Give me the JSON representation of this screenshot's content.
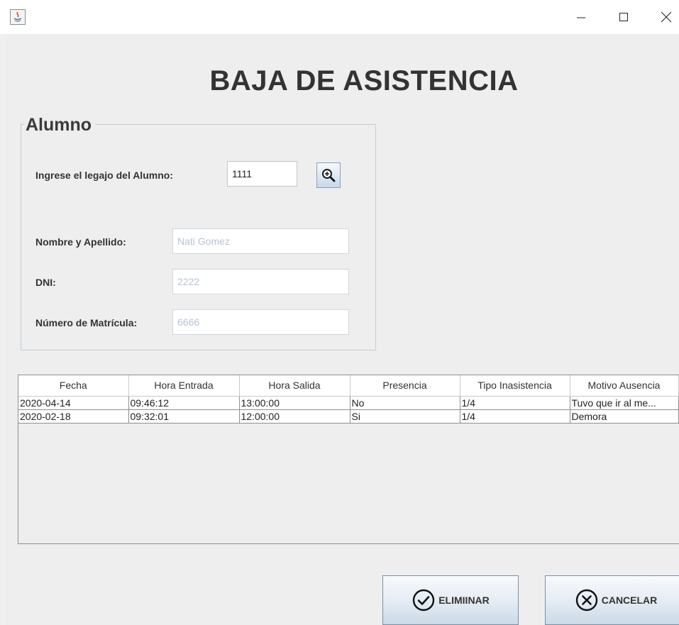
{
  "window": {
    "icons": {
      "app": "java-app-icon",
      "minimize": "minimize-icon",
      "maximize": "maximize-icon",
      "close": "close-icon"
    }
  },
  "page": {
    "title": "BAJA DE ASISTENCIA"
  },
  "alumno": {
    "legend": "Alumno",
    "legajo_label": "Ingrese el legajo del Alumno:",
    "legajo_value": "1111",
    "search_icon": "zoom-in-search-icon",
    "nombre_label": "Nombre y Apellido:",
    "nombre_value": "Nati Gomez",
    "dni_label": "DNI:",
    "dni_value": "2222",
    "matricula_label": "Número de Matrícula:",
    "matricula_value": "6666"
  },
  "table": {
    "columns": [
      "Fecha",
      "Hora Entrada",
      "Hora Salida",
      "Presencia",
      "Tipo Inasistencia",
      "Motivo Ausencia"
    ],
    "rows": [
      [
        "2020-04-14",
        "09:46:12",
        "13:00:00",
        "No",
        "1/4",
        "Tuvo que ir al me..."
      ],
      [
        "2020-02-18",
        "09:32:01",
        "12:00:00",
        "Si",
        "1/4",
        "Demora"
      ]
    ]
  },
  "buttons": {
    "eliminar_label": "ELIMIINAR",
    "eliminar_icon": "check-circle-icon",
    "cancelar_label": "CANCELAR",
    "cancelar_icon": "x-circle-icon"
  }
}
